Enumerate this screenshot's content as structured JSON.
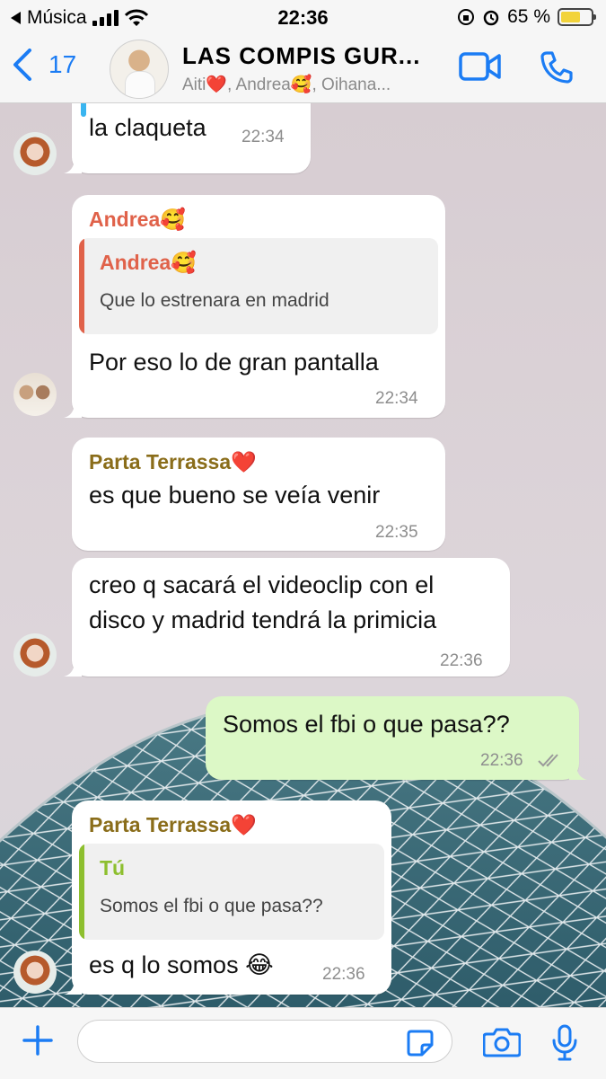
{
  "status_bar": {
    "back_app": "Música",
    "time": "22:36",
    "battery": "65 %",
    "battery_level": 0.65
  },
  "header": {
    "back_count": "17",
    "title": "LAS  COMPIS GUR...",
    "subtitle": "Aiti❤️, Andrea🥰, Oihana..."
  },
  "colors": {
    "accent": "#1b7cf4",
    "andrea": "#e0624a",
    "parta": "#8a6d1a",
    "you": "#8dbf2e",
    "outgoing_bubble": "#dcf8c6"
  },
  "messages": [
    {
      "text": "la claqueta",
      "time": "22:34"
    },
    {
      "sender": "Andrea🥰",
      "quote_name": "Andrea🥰",
      "quote_text": "Que lo estrenara en madrid",
      "text": "Por eso lo de gran pantalla",
      "time": "22:34"
    },
    {
      "sender": "Parta Terrassa❤️",
      "text": "es que bueno se veía venir",
      "time": "22:35"
    },
    {
      "lines": [
        "creo q sacará el videoclip con el",
        "disco y madrid tendrá la primicia"
      ],
      "time": "22:36"
    },
    {
      "text": "Somos el fbi o que pasa??",
      "time": "22:36",
      "status": "read"
    },
    {
      "sender": "Parta Terrassa❤️",
      "quote_name": "Tú",
      "quote_text": "Somos el fbi o que pasa??",
      "text": "es q lo somos 😂",
      "time": "22:36"
    }
  ],
  "input": {
    "placeholder": ""
  }
}
